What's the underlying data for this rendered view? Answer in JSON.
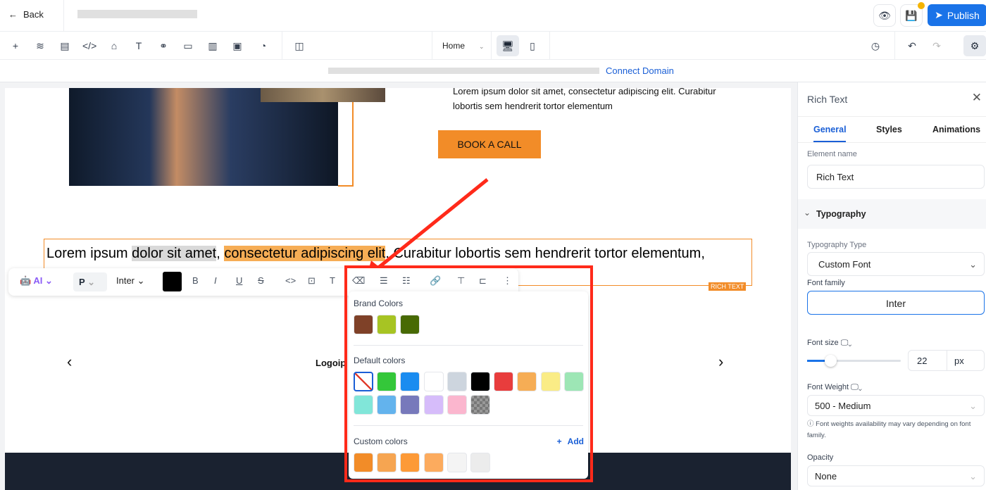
{
  "topbar": {
    "back_label": "Back",
    "publish_label": "Publish",
    "notification_color": "#f5b400"
  },
  "toolbar": {
    "page_select": "Home"
  },
  "urlbar": {
    "connect_domain": "Connect Domain"
  },
  "canvas": {
    "intro_text": "Lorem ipsum dolor sit amet, consectetur adipiscing elit. Curabitur lobortis sem hendrerit tortor elementum",
    "book_call": "BOOK A CALL",
    "rich_text": {
      "before": "Lorem ipsum ",
      "selected": "dolor sit amet",
      "comma": ", ",
      "highlighted": "consectetur adipiscing elit",
      "after": ". Curabitur lobortis sem hendrerit tortor elementum,"
    },
    "rich_tag": "RICH TEXT",
    "logo_text": "Logoip",
    "prev": "‹",
    "next": "›"
  },
  "rich_toolbar": {
    "ai_label": "AI",
    "tag_select": "P",
    "font_select": "Inter",
    "text_color": "#000000"
  },
  "color_popup": {
    "brand_title": "Brand Colors",
    "brand_colors": [
      "#7f4128",
      "#a7c423",
      "#486a04"
    ],
    "default_title": "Default colors",
    "default_colors": [
      "transparent",
      "#34c73a",
      "#1a8cf0",
      "#ffffff",
      "#cdd5de",
      "#000000",
      "#e83d3d",
      "#f6ad55",
      "#faec86",
      "#9de6b5",
      "#81e6d9",
      "#63b3ed",
      "#7779bb",
      "#d6bcfa",
      "#fbb6ce",
      "checker"
    ],
    "custom_title": "Custom colors",
    "add_label": "Add",
    "custom_colors": [
      "#f28c28",
      "#f6a551",
      "#fd9a37",
      "#fcab5e",
      "#f4f4f4",
      "#ececec"
    ]
  },
  "panel": {
    "title": "Rich Text",
    "tabs": [
      "General",
      "Styles",
      "Animations"
    ],
    "element_name_label": "Element name",
    "element_name": "Rich Text",
    "typography_section": "Typography",
    "typography_type_label": "Typography Type",
    "typography_type": "Custom Font",
    "font_family_label": "Font family",
    "font_family": "Inter",
    "font_size_label": "Font size",
    "font_size": "22",
    "font_unit": "px",
    "font_size_slider": 0.25,
    "font_weight_label": "Font Weight",
    "font_weight": "500 - Medium",
    "font_weight_note": "Font weights availability may vary depending on font family.",
    "opacity_label": "Opacity",
    "opacity": "None"
  }
}
